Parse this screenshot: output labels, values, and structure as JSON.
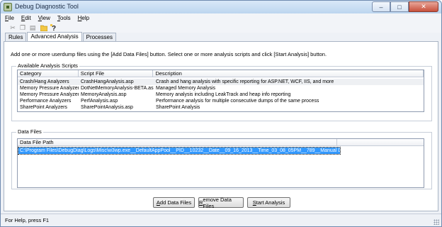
{
  "window": {
    "title": "Debug Diagnostic Tool",
    "minimize": "–",
    "maximize": "□",
    "close": "✕"
  },
  "menu": [
    {
      "pre": "",
      "key": "F",
      "post": "ile"
    },
    {
      "pre": "",
      "key": "E",
      "post": "dit"
    },
    {
      "pre": "",
      "key": "V",
      "post": "iew"
    },
    {
      "pre": "",
      "key": "T",
      "post": "ools"
    },
    {
      "pre": "",
      "key": "H",
      "post": "elp"
    }
  ],
  "toolbar": {
    "cut": "✂",
    "copy": "❐",
    "paste": "▤",
    "open": "📂",
    "help": "?"
  },
  "tabs": {
    "rules": "Rules",
    "advanced": "Advanced Analysis",
    "processes": "Processes"
  },
  "instructions": "Add one or more userdump files using the [Add Data Files] button. Select one or more analysis scripts and click [Start Analysis] button.",
  "scripts": {
    "legend": "Available Analysis Scripts",
    "headers": {
      "category": "Category",
      "file": "Script File",
      "description": "Description"
    },
    "rows": [
      {
        "category": "Crash/Hang Analyzers",
        "file": "CrashHangAnalysis.asp",
        "description": "Crash and hang analysis with specific reporting for ASP.NET, WCF, IIS, and more"
      },
      {
        "category": "Memory Pressure Analyzers",
        "file": "DotNetMemoryAnalysis-BETA.asp",
        "description": "Managed Memory Analysis"
      },
      {
        "category": "Memory Pressure Analyzers",
        "file": "MemoryAnalysis.asp",
        "description": "Memory analysis including LeakTrack and heap info reporting"
      },
      {
        "category": "Performance Analyzers",
        "file": "PerfAnalysis.asp",
        "description": "Performance analysis for multiple consecutive dumps of the same process"
      },
      {
        "category": "SharePoint Analyzers",
        "file": "SharePointAnalysis.asp",
        "description": "SharePoint Analysis"
      }
    ]
  },
  "datafiles": {
    "legend": "Data Files",
    "header": "Data File Path",
    "selected": "C:\\Program Files\\DebugDiag\\Logs\\Misc\\w3wp.exe__DefaultAppPool__PID__10232__Date__09_16_2013__Time_03_08_05PM__789__Manual Dump.dmp"
  },
  "buttons": {
    "add": {
      "key": "A",
      "rest": "dd Data Files"
    },
    "remove": {
      "key": "R",
      "rest": "emove Data Files"
    },
    "start": {
      "key": "S",
      "rest": "tart Analysis"
    }
  },
  "status": "For Help, press F1"
}
